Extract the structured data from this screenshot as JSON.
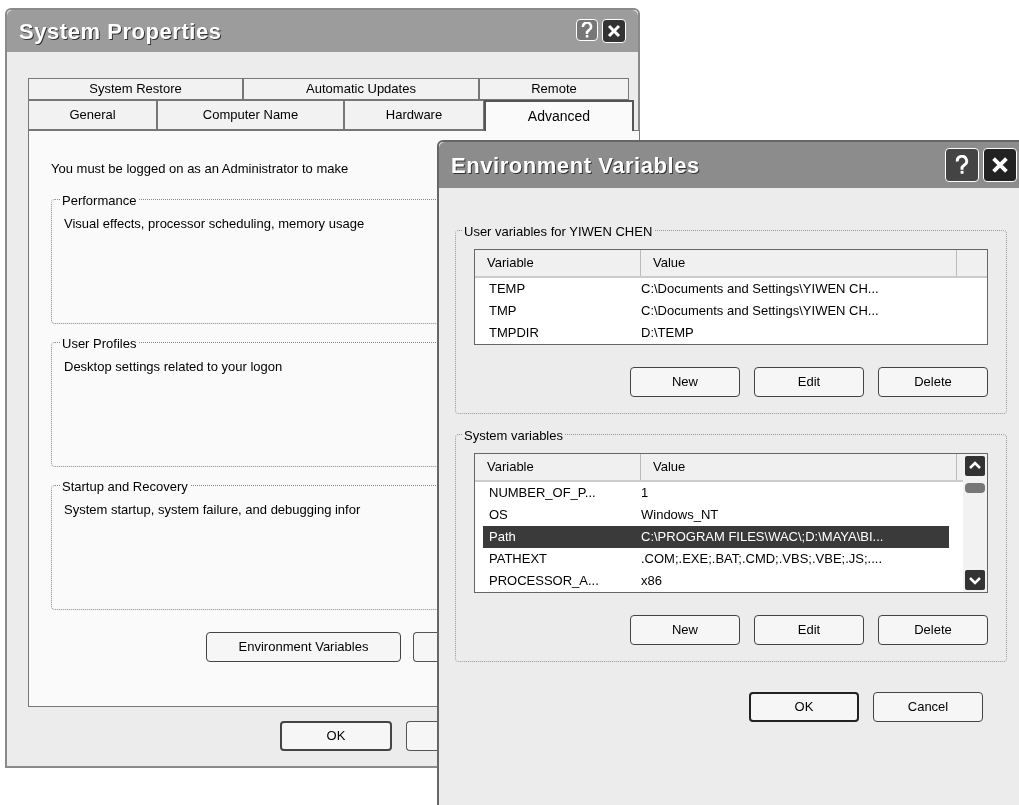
{
  "system_properties": {
    "title": "System Properties",
    "tabs_row_1": [
      {
        "label": "System Restore",
        "selected": false
      },
      {
        "label": "Automatic Updates",
        "selected": false
      },
      {
        "label": "Remote",
        "selected": false
      }
    ],
    "tabs_row_2": [
      {
        "label": "General",
        "selected": false
      },
      {
        "label": "Computer Name",
        "selected": false
      },
      {
        "label": "Hardware",
        "selected": false
      },
      {
        "label": "Advanced",
        "selected": true
      }
    ],
    "notice": "You must be logged on as an Administrator to make",
    "groups": [
      {
        "title": "Performance",
        "description": "Visual effects, processor scheduling, memory usage"
      },
      {
        "title": "User Profiles",
        "description": "Desktop settings related to your logon"
      },
      {
        "title": "Startup and Recovery",
        "description": "System startup, system failure, and debugging infor"
      }
    ],
    "panel_buttons": [
      "Environment Variables"
    ],
    "footer_buttons": [
      "OK"
    ]
  },
  "environment_variables": {
    "title": "Environment Variables",
    "user_section": {
      "label": "User variables for YIWEN CHEN",
      "columns": [
        "Variable",
        "Value"
      ],
      "rows": [
        {
          "variable": "TEMP",
          "value": "C:\\Documents and Settings\\YIWEN CH...",
          "selected": false
        },
        {
          "variable": "TMP",
          "value": "C:\\Documents and Settings\\YIWEN CH...",
          "selected": false
        },
        {
          "variable": "TMPDIR",
          "value": "D:\\TEMP",
          "selected": false
        }
      ],
      "buttons": [
        "New",
        "Edit",
        "Delete"
      ]
    },
    "system_section": {
      "label": "System variables",
      "columns": [
        "Variable",
        "Value"
      ],
      "rows": [
        {
          "variable": "NUMBER_OF_P...",
          "value": "1",
          "selected": false
        },
        {
          "variable": "OS",
          "value": "Windows_NT",
          "selected": false
        },
        {
          "variable": "Path",
          "value": "C:\\PROGRAM FILES\\WAC\\;D:\\MAYA\\BI...",
          "selected": true
        },
        {
          "variable": "PATHEXT",
          "value": ".COM;.EXE;.BAT;.CMD;.VBS;.VBE;.JS;....",
          "selected": false
        },
        {
          "variable": "PROCESSOR_A...",
          "value": "x86",
          "selected": false
        }
      ],
      "buttons": [
        "New",
        "Edit",
        "Delete"
      ]
    },
    "footer_buttons": [
      "OK",
      "Cancel"
    ]
  }
}
